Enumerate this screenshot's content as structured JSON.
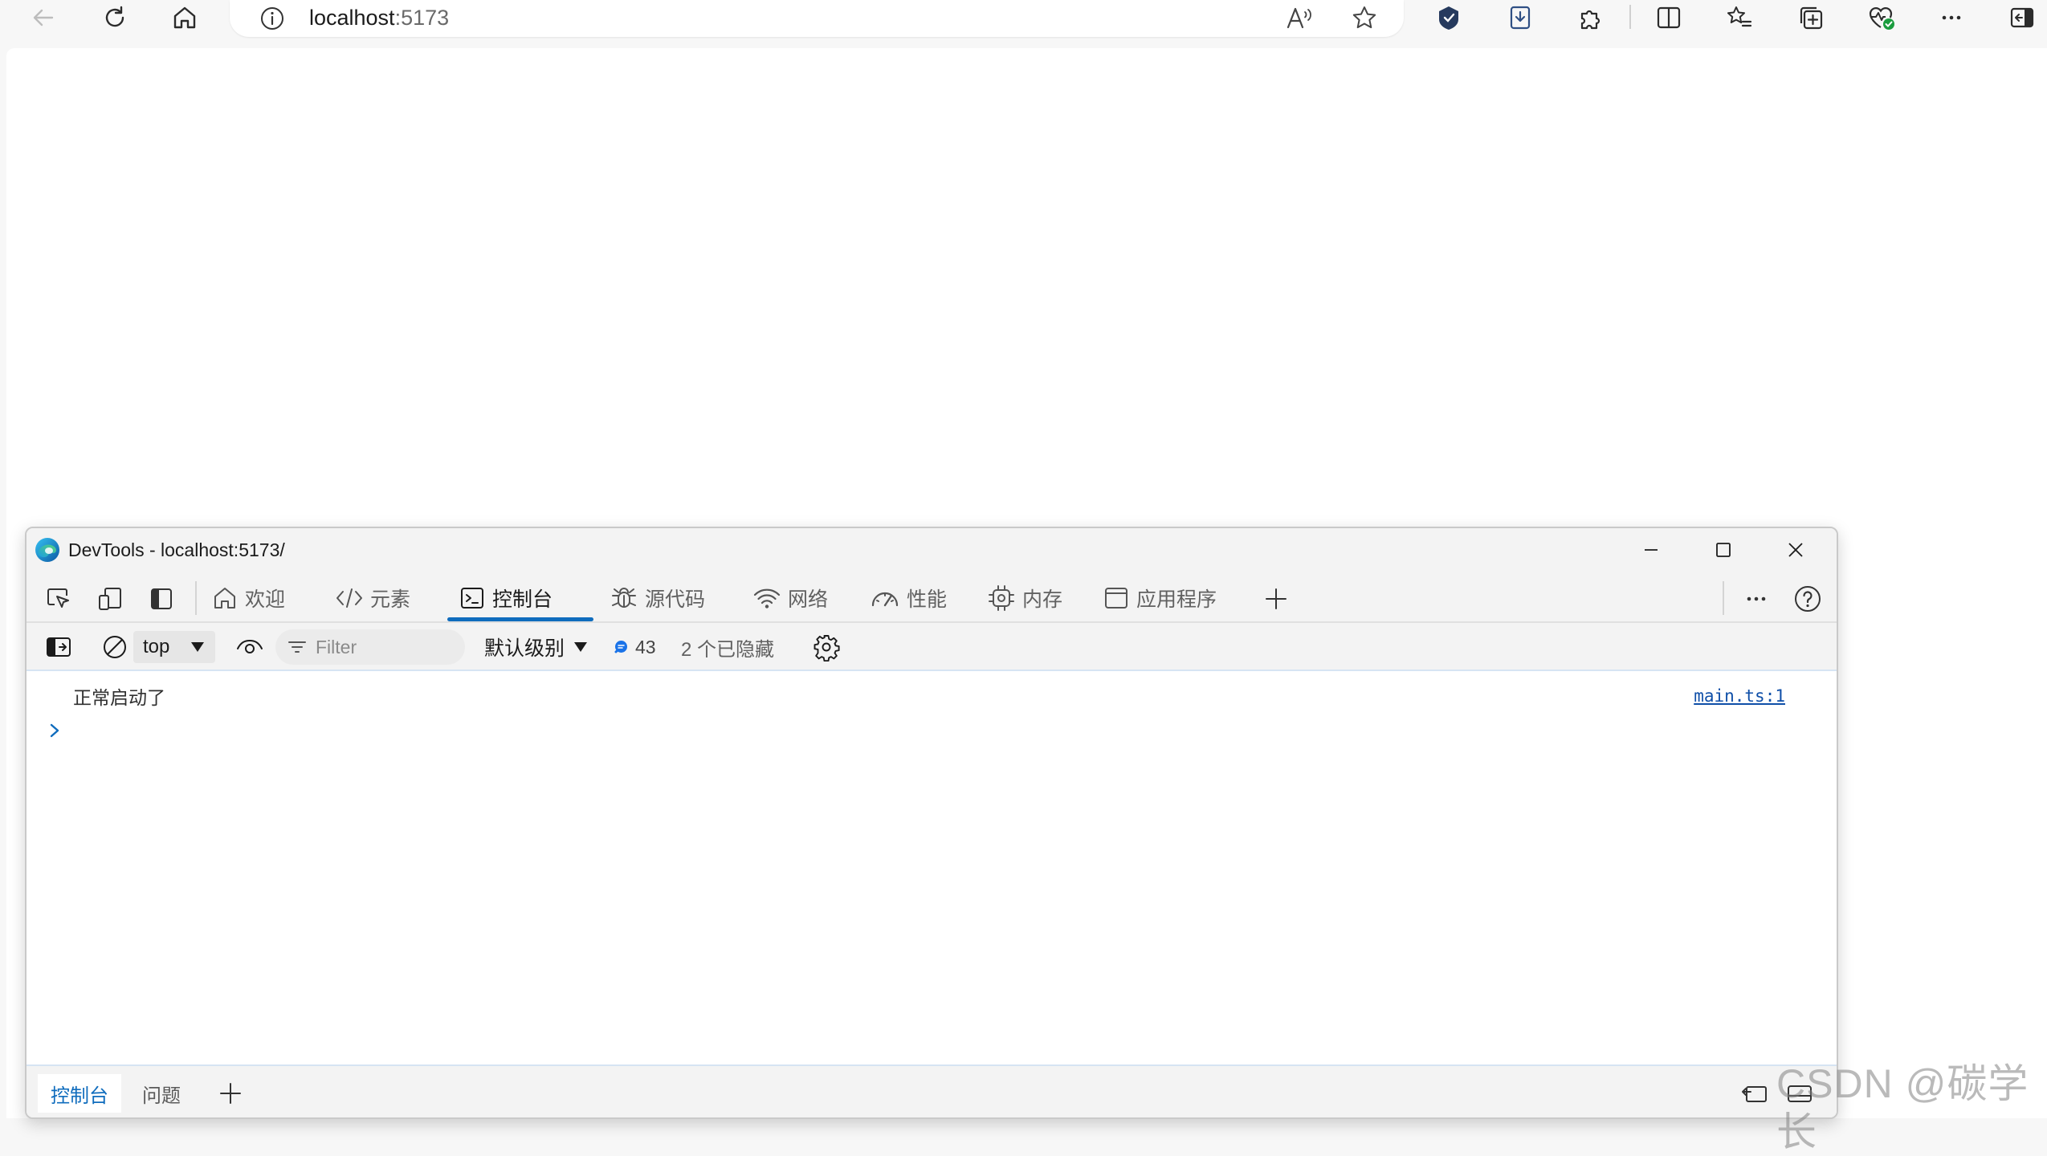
{
  "browser": {
    "address_host": "localhost",
    "address_port": ":5173"
  },
  "devtools": {
    "window_title": "DevTools - localhost:5173/",
    "tabs": [
      {
        "label": "欢迎",
        "icon": "home-icon"
      },
      {
        "label": "元素",
        "icon": "code-icon"
      },
      {
        "label": "控制台",
        "icon": "console-icon"
      },
      {
        "label": "源代码",
        "icon": "bug-icon"
      },
      {
        "label": "网络",
        "icon": "wifi-icon"
      },
      {
        "label": "性能",
        "icon": "gauge-icon"
      },
      {
        "label": "内存",
        "icon": "chip-icon"
      },
      {
        "label": "应用程序",
        "icon": "app-window-icon"
      }
    ],
    "active_tab": "控制台",
    "filterbar": {
      "context": "top",
      "filter_placeholder": "Filter",
      "level": "默认级别",
      "message_count": "43",
      "hidden": "2 个已隐藏"
    },
    "console": {
      "log_message": "正常启动了",
      "log_source": "main.ts:1"
    },
    "drawer": {
      "tabs": [
        "控制台",
        "问题"
      ]
    }
  },
  "watermark": "CSDN @碳学长",
  "colors": {
    "accent": "#0f6cbd",
    "link": "#0f4fa8",
    "chrome_bg": "#f3f3f3",
    "message_badge": "#1a73e8"
  }
}
